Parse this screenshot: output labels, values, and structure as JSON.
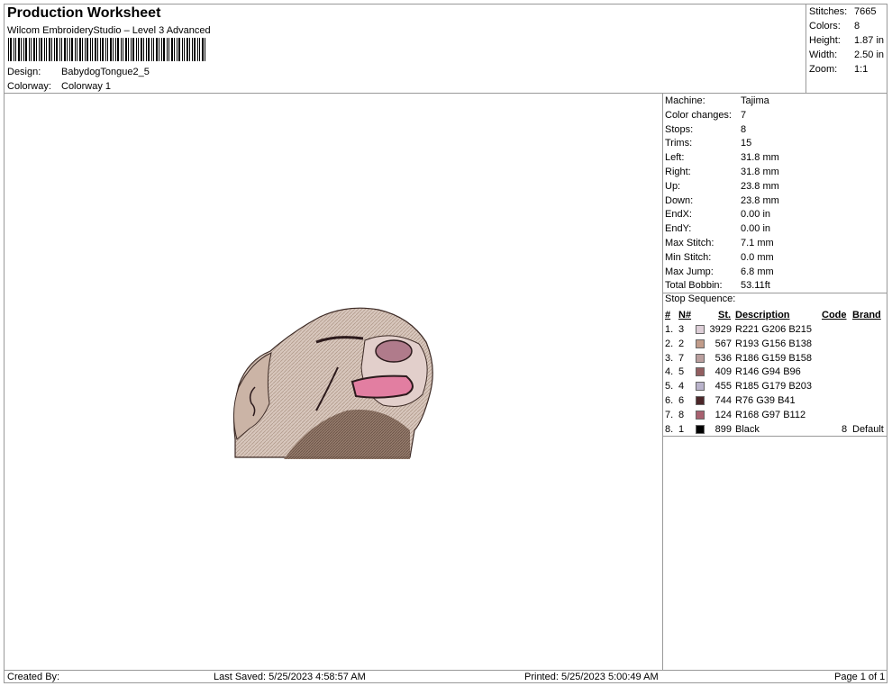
{
  "header": {
    "title": "Production Worksheet",
    "software": "Wilcom EmbroideryStudio – Level 3 Advanced",
    "design_label": "Design:",
    "design_value": "BabydogTongue2_5",
    "colorway_label": "Colorway:",
    "colorway_value": "Colorway 1"
  },
  "stats": [
    {
      "label": "Stitches:",
      "value": "7665"
    },
    {
      "label": "Colors:",
      "value": "8"
    },
    {
      "label": "Height:",
      "value": "1.87 in"
    },
    {
      "label": "Width:",
      "value": "2.50 in"
    },
    {
      "label": "Zoom:",
      "value": "1:1"
    }
  ],
  "machine": [
    {
      "label": "Machine:",
      "value": "Tajima"
    },
    {
      "label": "Color changes:",
      "value": "7"
    },
    {
      "label": "Stops:",
      "value": "8"
    },
    {
      "label": "Trims:",
      "value": "15"
    },
    {
      "label": "Left:",
      "value": "31.8 mm"
    },
    {
      "label": "Right:",
      "value": "31.8 mm"
    },
    {
      "label": "Up:",
      "value": "23.8 mm"
    },
    {
      "label": "Down:",
      "value": "23.8 mm"
    },
    {
      "label": "EndX:",
      "value": "0.00 in"
    },
    {
      "label": "EndY:",
      "value": "0.00 in"
    },
    {
      "label": "Max Stitch:",
      "value": "7.1 mm"
    },
    {
      "label": "Min Stitch:",
      "value": "0.0 mm"
    },
    {
      "label": "Max Jump:",
      "value": "6.8 mm"
    },
    {
      "label": "Total Bobbin:",
      "value": "53.11ft"
    }
  ],
  "stop_sequence": {
    "title": "Stop Sequence:",
    "headers": {
      "num": "#",
      "n": "N#",
      "st": "St.",
      "desc": "Description",
      "code": "Code",
      "brand": "Brand"
    },
    "rows": [
      {
        "num": "1.",
        "n": "3",
        "color": "#DDCED7",
        "st": "3929",
        "desc": "R221 G206 B215",
        "code": "",
        "brand": ""
      },
      {
        "num": "2.",
        "n": "2",
        "color": "#C19C8A",
        "st": "567",
        "desc": "R193 G156 B138",
        "code": "",
        "brand": ""
      },
      {
        "num": "3.",
        "n": "7",
        "color": "#BA9F9E",
        "st": "536",
        "desc": "R186 G159 B158",
        "code": "",
        "brand": ""
      },
      {
        "num": "4.",
        "n": "5",
        "color": "#925E60",
        "st": "409",
        "desc": "R146 G94 B96",
        "code": "",
        "brand": ""
      },
      {
        "num": "5.",
        "n": "4",
        "color": "#B9B3CB",
        "st": "455",
        "desc": "R185 G179 B203",
        "code": "",
        "brand": ""
      },
      {
        "num": "6.",
        "n": "6",
        "color": "#4C2729",
        "st": "744",
        "desc": "R76 G39 B41",
        "code": "",
        "brand": ""
      },
      {
        "num": "7.",
        "n": "8",
        "color": "#A86170",
        "st": "124",
        "desc": "R168 G97 B112",
        "code": "",
        "brand": ""
      },
      {
        "num": "8.",
        "n": "1",
        "color": "#000000",
        "st": "899",
        "desc": "Black",
        "code": "8",
        "brand": "Default"
      }
    ]
  },
  "footer": {
    "created": "Created By:",
    "saved": "Last Saved: 5/25/2023 4:58:57 AM",
    "printed": "Printed: 5/25/2023 5:00:49 AM",
    "page": "Page 1 of 1"
  }
}
